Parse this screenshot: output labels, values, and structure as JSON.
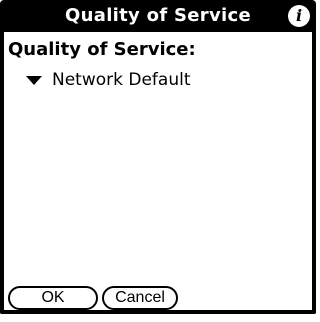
{
  "title_bar": {
    "title": "Quality of Service",
    "info_icon": "info-icon",
    "info_glyph": "i"
  },
  "form": {
    "label": "Quality of Service:",
    "popup": {
      "selected": "Network Default",
      "icon": "triangle-down-icon"
    }
  },
  "buttons": {
    "ok": "OK",
    "cancel": "Cancel"
  },
  "colors": {
    "background": "#ffffff",
    "foreground": "#000000"
  }
}
